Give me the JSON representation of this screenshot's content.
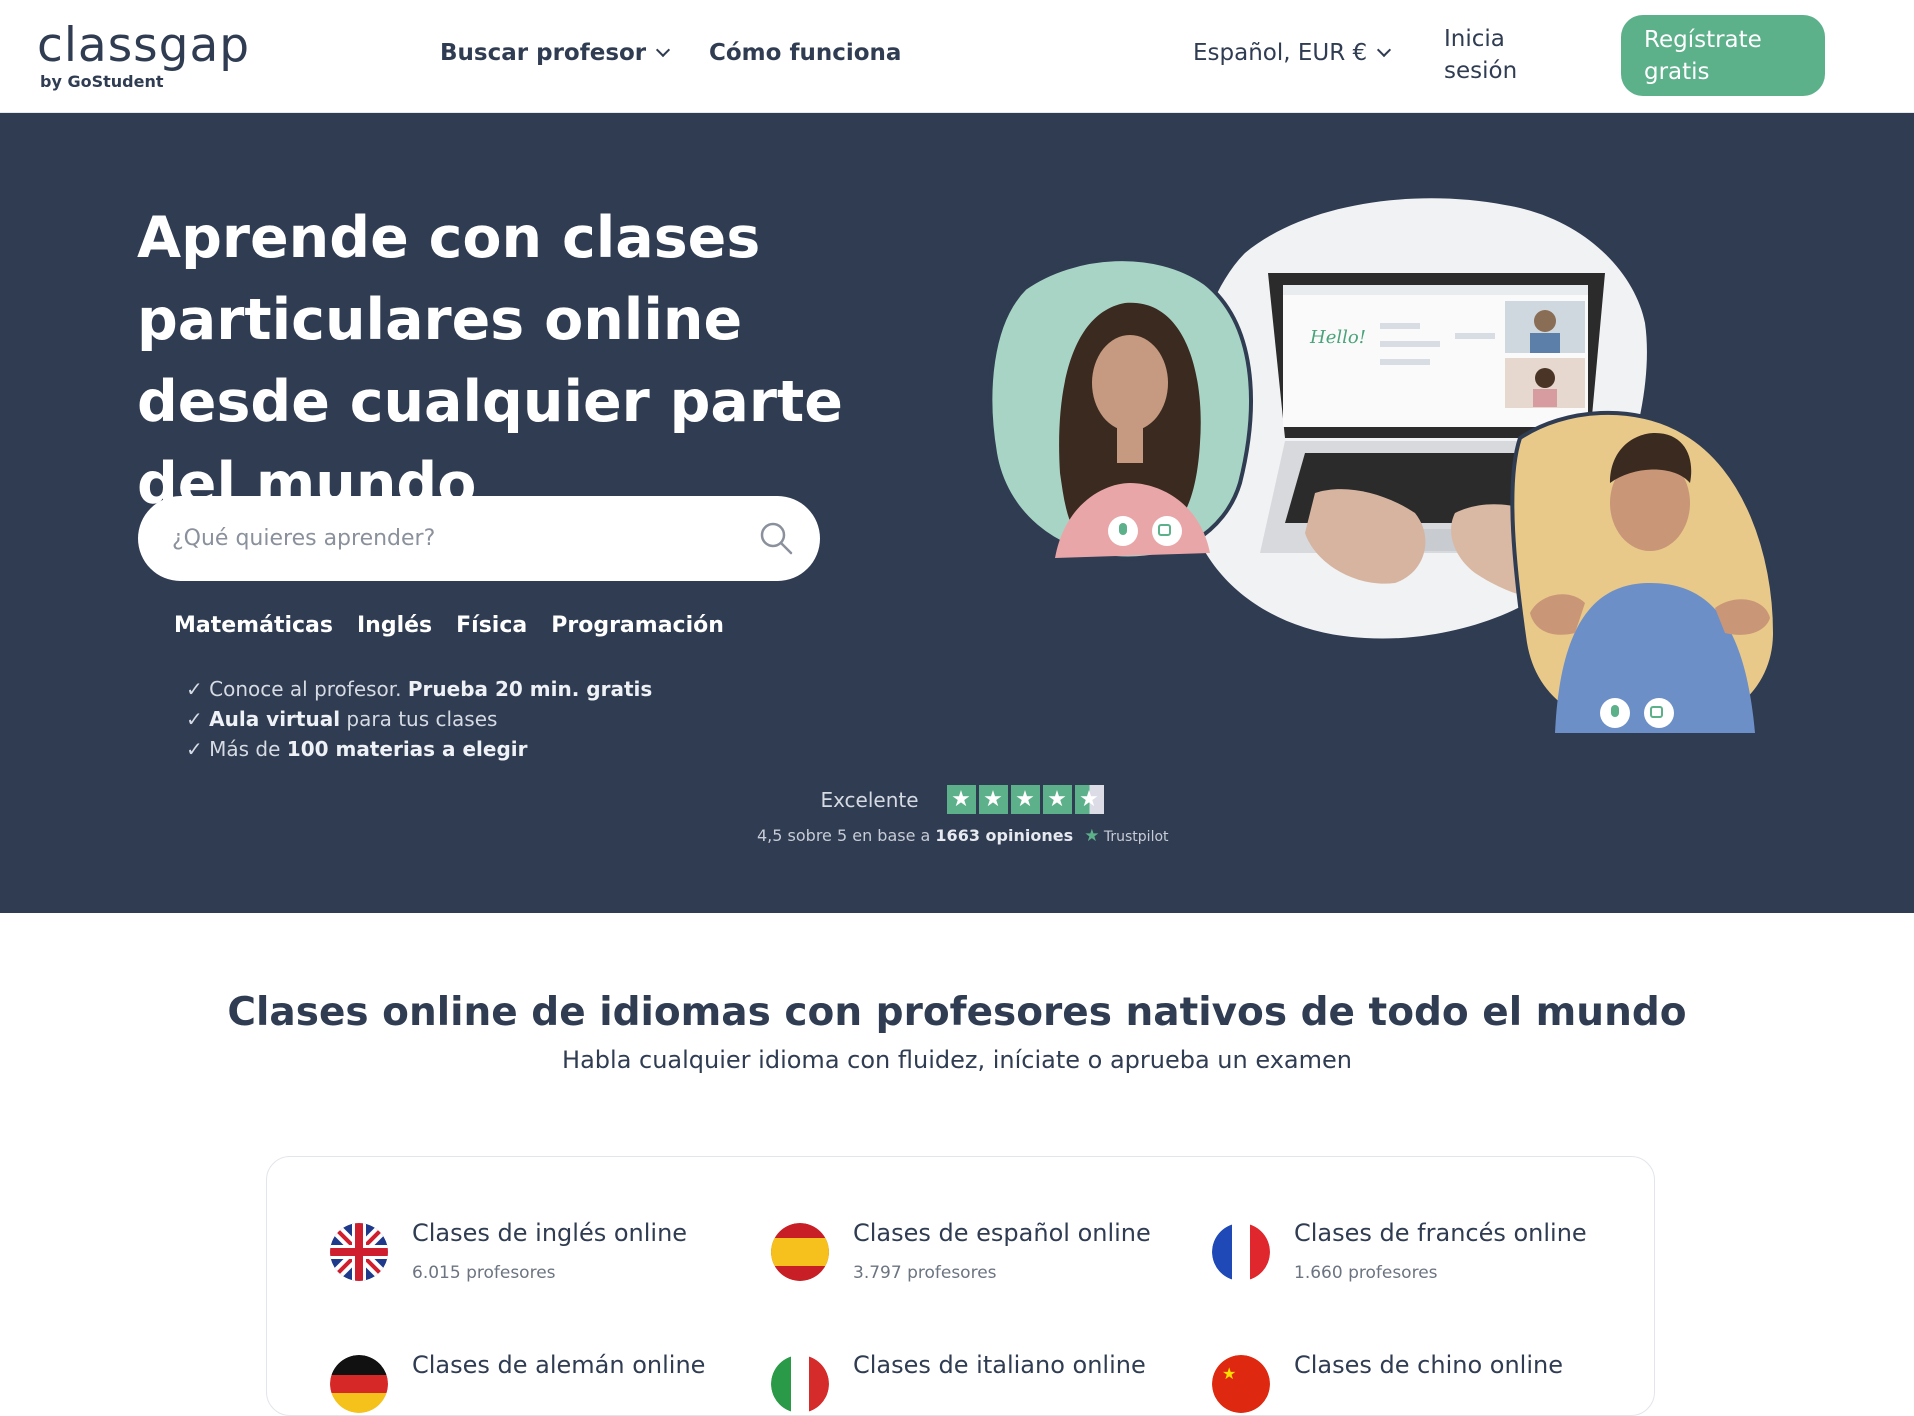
{
  "header": {
    "logo_text": "classgap",
    "logo_sub": "by GoStudent",
    "nav": [
      {
        "label": "Buscar profesor"
      },
      {
        "label": "Cómo funciona"
      }
    ],
    "language": "Español, EUR €",
    "login": "Inicia sesión",
    "signup": "Regístrate gratis",
    "accent": "#5cb08a",
    "navy": "#2f3c52"
  },
  "hero": {
    "title": "Aprende con clases particulares online desde cualquier parte del mundo",
    "search_placeholder": "¿Qué quieres aprender?",
    "chips": [
      "Matemáticas",
      "Inglés",
      "Física",
      "Programación"
    ],
    "bullets": [
      {
        "pre": "Conoce al profesor. ",
        "bold": "Prueba 20 min. gratis",
        "post": ""
      },
      {
        "pre": "",
        "bold": "Aula virtual",
        "post": " para tus clases"
      },
      {
        "pre": "Más de ",
        "bold": "100 materias a elegir",
        "post": ""
      }
    ],
    "trustpilot": {
      "rating_label": "Excelente",
      "stars": 4.5,
      "summary_pre": "4,5 sobre 5 en base a ",
      "summary_bold": "1663 opiniones",
      "brand": "Trustpilot"
    },
    "laptop_text": "Hello!"
  },
  "languages": {
    "title": "Clases online de idiomas con profesores nativos de todo el mundo",
    "subtitle": "Habla cualquier idioma con fluidez, iníciate o aprueba un examen",
    "items": [
      {
        "name": "Clases de inglés online",
        "count": "6.015 profesores",
        "flag": "uk-flag-icon"
      },
      {
        "name": "Clases de español online",
        "count": "3.797 profesores",
        "flag": "spain-flag-icon"
      },
      {
        "name": "Clases de francés online",
        "count": "1.660 profesores",
        "flag": "france-flag-icon"
      },
      {
        "name": "Clases de alemán online",
        "count": "",
        "flag": "germany-flag-icon"
      },
      {
        "name": "Clases de italiano online",
        "count": "",
        "flag": "italy-flag-icon"
      },
      {
        "name": "Clases de chino online",
        "count": "",
        "flag": "china-flag-icon"
      }
    ]
  }
}
